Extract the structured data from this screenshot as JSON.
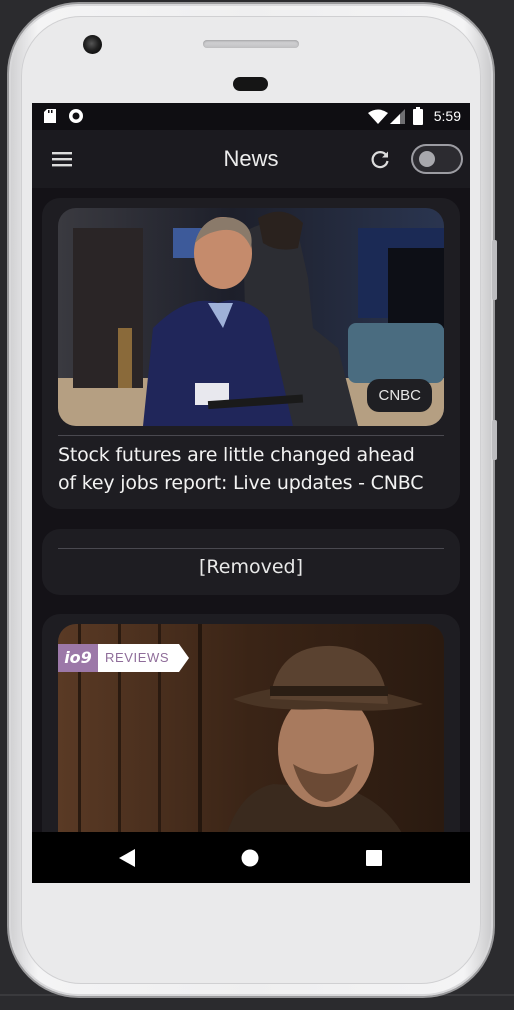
{
  "app": {
    "title": "News",
    "status_time": "5:59",
    "theme_toggle_on": false
  },
  "articles": [
    {
      "source": "CNBC",
      "headline_line1": "Stock futures are little changed ahead",
      "headline_line2": "of key jobs report: Live updates - CNBC",
      "image": "trader-on-stock-exchange-floor"
    },
    {
      "removed_label": "[Removed]"
    },
    {
      "image": "man-in-fedora-hat",
      "badge_logo": "io9",
      "badge_label": "REVIEWS"
    }
  ],
  "colors": {
    "background": "#141217",
    "appbar": "#1b1a1f",
    "card": "#1e1d22",
    "io9_purple": "#9c78a8"
  },
  "icons": {
    "menu": "hamburger-menu-icon",
    "refresh": "refresh-icon",
    "back": "back-triangle-icon",
    "home": "home-circle-icon",
    "recents": "recents-square-icon"
  }
}
